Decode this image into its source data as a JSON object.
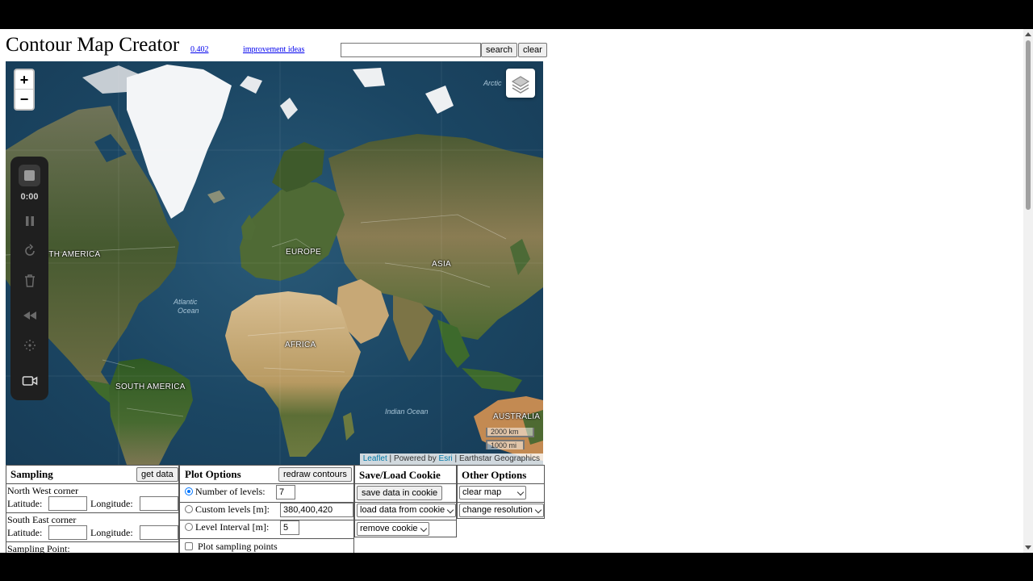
{
  "header": {
    "title": "Contour Map Creator",
    "version": "0.402",
    "ideas_link": "improvement ideas",
    "search_value": "",
    "search_label": "search",
    "clear_label": "clear"
  },
  "map": {
    "zoom_in": "+",
    "zoom_out": "−",
    "labels": {
      "north_america": "RTH AMERICA",
      "europe": "EUROPE",
      "asia": "ASIA",
      "africa": "AFRICA",
      "south_america": "SOUTH AMERICA",
      "australia": "AUSTRALIA",
      "arctic": "Arctic",
      "atlantic_1": "Atlantic",
      "atlantic_2": "Ocean",
      "indian": "Indian Ocean"
    },
    "scale_km": "2000 km",
    "scale_mi": "1000 mi",
    "attribution": {
      "leaflet": "Leaflet",
      "powered": "Powered by",
      "esri": "Esri",
      "source": "Earthstar Geographics"
    },
    "colors": {
      "water": "#1b4663",
      "desert": "#d9c39a",
      "forest": "#3d5a2c",
      "ice": "#f2f4f6"
    }
  },
  "recorder": {
    "time": "0:00",
    "icons": [
      "stop-icon",
      "pause-icon",
      "restart-icon",
      "trash-icon",
      "rewind-icon",
      "sparkle-icon",
      "camera-icon"
    ]
  },
  "sampling": {
    "title": "Sampling",
    "get_data": "get data",
    "nw_corner": "North West corner",
    "se_corner": "South East corner",
    "latitude": "Latitude:",
    "longitude": "Longitude:",
    "sampling_point": "Sampling Point:"
  },
  "plot_options": {
    "title": "Plot Options",
    "redraw": "redraw contours",
    "num_levels_label": "Number of levels:",
    "num_levels_value": "7",
    "custom_levels_label": "Custom levels [m]:",
    "custom_levels_value": "380,400,420",
    "interval_label": "Level Interval [m]:",
    "interval_value": "5",
    "plot_points_label": "Plot sampling points"
  },
  "cookie": {
    "title": "Save/Load Cookie",
    "save": "save data in cookie",
    "load": "load data from cookie",
    "remove": "remove cookie"
  },
  "other": {
    "title": "Other Options",
    "clear_map": "clear map",
    "change_resolution": "change resolution"
  }
}
